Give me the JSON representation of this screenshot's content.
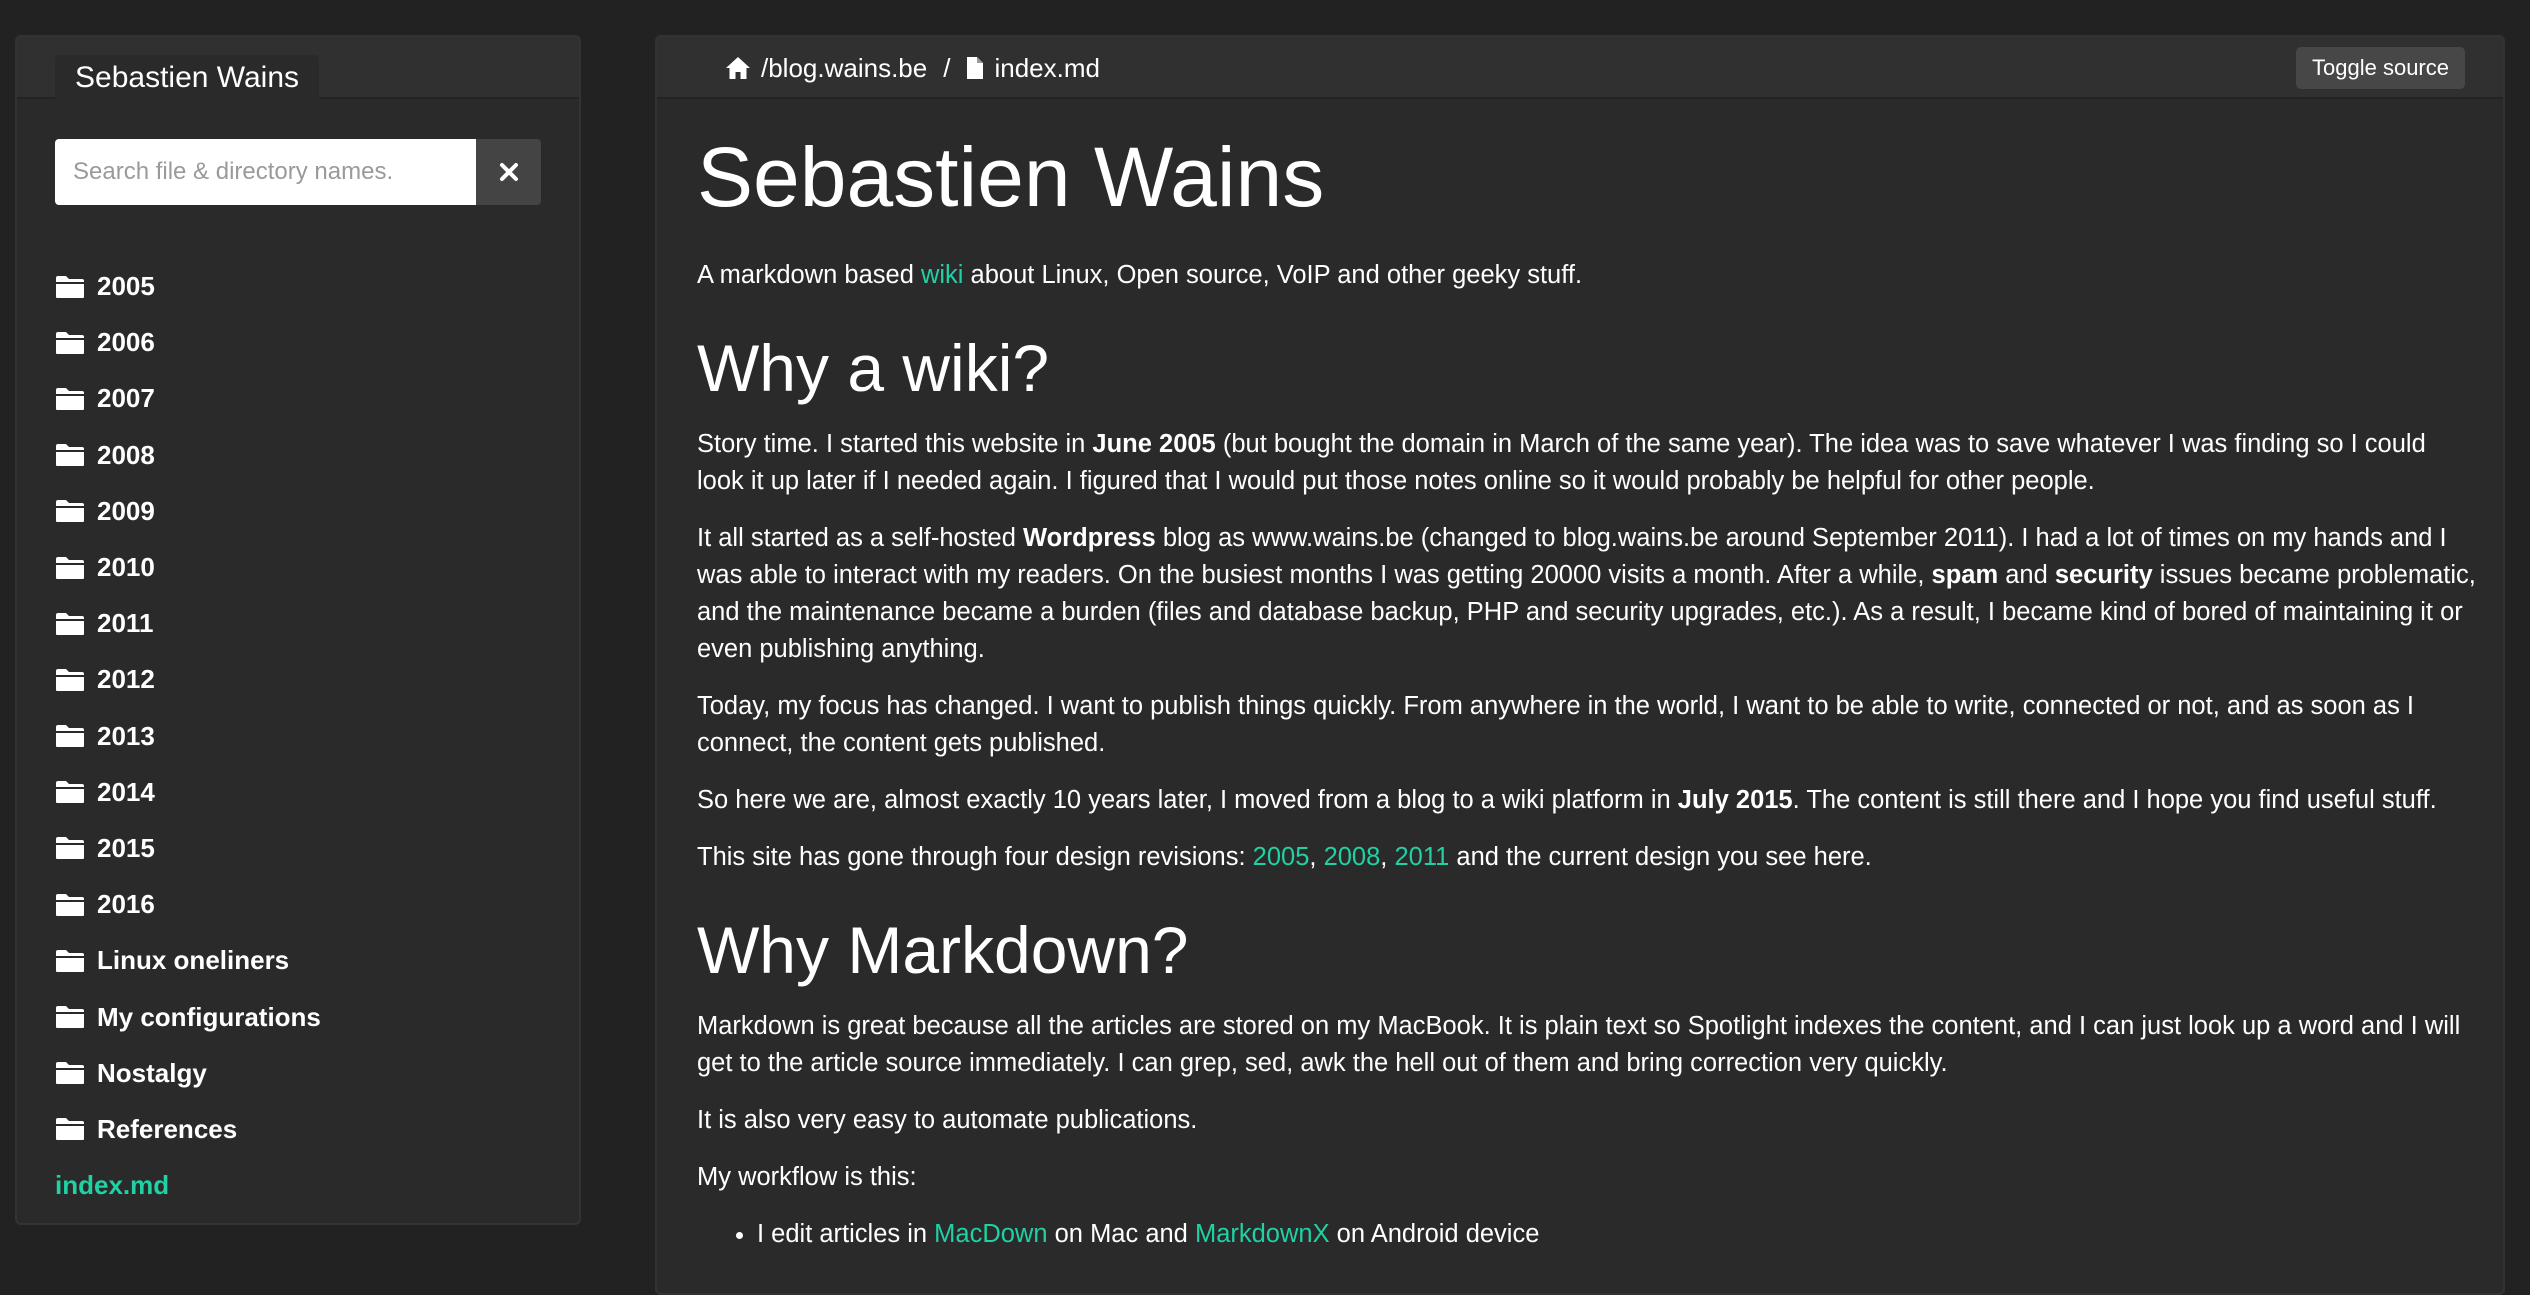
{
  "sidebar": {
    "site_title": "Sebastien Wains",
    "search": {
      "placeholder": "Search file & directory names.",
      "value": ""
    },
    "items": [
      {
        "label": "2005",
        "type": "folder"
      },
      {
        "label": "2006",
        "type": "folder"
      },
      {
        "label": "2007",
        "type": "folder"
      },
      {
        "label": "2008",
        "type": "folder"
      },
      {
        "label": "2009",
        "type": "folder"
      },
      {
        "label": "2010",
        "type": "folder"
      },
      {
        "label": "2011",
        "type": "folder"
      },
      {
        "label": "2012",
        "type": "folder"
      },
      {
        "label": "2013",
        "type": "folder"
      },
      {
        "label": "2014",
        "type": "folder"
      },
      {
        "label": "2015",
        "type": "folder"
      },
      {
        "label": "2016",
        "type": "folder"
      },
      {
        "label": "Linux oneliners",
        "type": "folder"
      },
      {
        "label": "My configurations",
        "type": "folder"
      },
      {
        "label": "Nostalgy",
        "type": "folder"
      },
      {
        "label": "References",
        "type": "folder"
      },
      {
        "label": "index.md",
        "type": "file"
      }
    ]
  },
  "topbar": {
    "path": "/blog.wains.be",
    "separator": "/",
    "file": "index.md",
    "toggle_label": "Toggle source"
  },
  "article": {
    "title": "Sebastien Wains",
    "intro": {
      "pre": "A markdown based ",
      "link": "wiki",
      "post": " about Linux, Open source, VoIP and other geeky stuff."
    },
    "h_why_wiki": "Why a wiki?",
    "p1": {
      "a": "Story time. I started this website in ",
      "b": "June 2005",
      "c": " (but bought the domain in March of the same year). The idea was to save whatever I was finding so I could look it up later if I needed again. I figured that I would put those notes online so it would probably be helpful for other people."
    },
    "p2": {
      "a": "It all started as a self-hosted ",
      "b": "Wordpress",
      "c": " blog as www.wains.be (changed to blog.wains.be around September 2011). I had a lot of times on my hands and I was able to interact with my readers. On the busiest months I was getting 20000 visits a month. After a while, ",
      "d": "spam",
      "e": " and ",
      "f": "security",
      "g": " issues became problematic, and the maintenance became a burden (files and database backup, PHP and security upgrades, etc.). As a result, I became kind of bored of maintaining it or even publishing anything."
    },
    "p3": "Today, my focus has changed. I want to publish things quickly. From anywhere in the world, I want to be able to write, connected or not, and as soon as I connect, the content gets published.",
    "p4": {
      "a": "So here we are, almost exactly 10 years later, I moved from a blog to a wiki platform in ",
      "b": "July 2015",
      "c": ". The content is still there and I hope you find useful stuff."
    },
    "p5": {
      "a": "This site has gone through four design revisions: ",
      "l1": "2005",
      "s1": ", ",
      "l2": "2008",
      "s2": ", ",
      "l3": "2011",
      "c": " and the current design you see here."
    },
    "h_why_markdown": "Why Markdown?",
    "p6": "Markdown is great because all the articles are stored on my MacBook. It is plain text so Spotlight indexes the content, and I can just look up a word and I will get to the article source immediately. I can grep, sed, awk the hell out of them and bring correction very quickly.",
    "p7": "It is also very easy to automate publications.",
    "p8": "My workflow is this:",
    "li1": {
      "a": "I edit articles in ",
      "l1": "MacDown",
      "b": " on Mac and ",
      "l2": "MarkdownX",
      "c": " on Android device"
    }
  },
  "colors": {
    "accent": "#1fd1a4",
    "background": "#222222",
    "panel": "#2a2a2a"
  },
  "icons": {
    "folder": "folder-icon",
    "home": "home-icon",
    "file": "file-icon",
    "clear": "close-icon"
  }
}
